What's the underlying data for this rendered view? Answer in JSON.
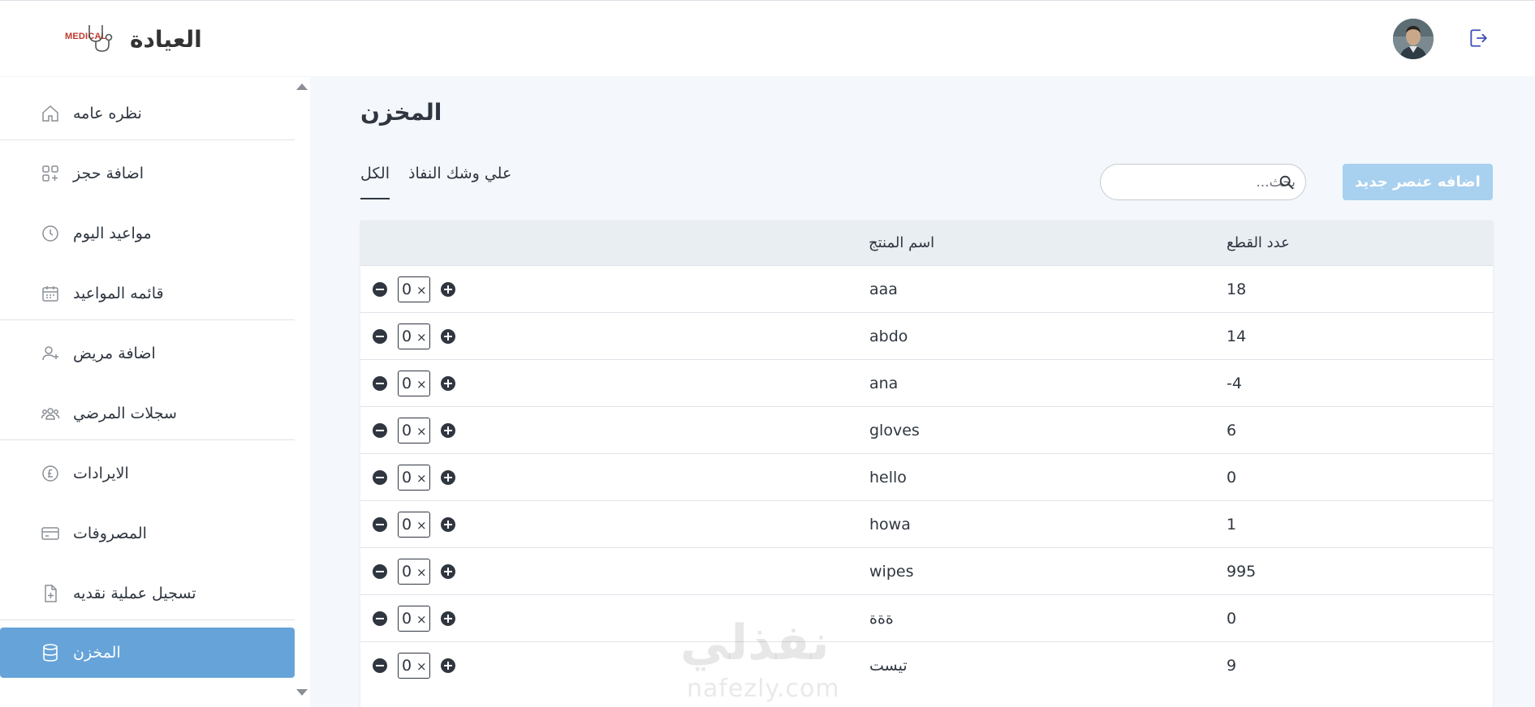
{
  "header": {
    "app_title": "العيادة",
    "logo_text": "MEDICAL",
    "logo_icon": "stethoscope-icon",
    "avatar_icon": "user-avatar",
    "logout_icon": "logout-icon"
  },
  "sidebar": {
    "items": [
      {
        "label": "نظره عامه",
        "icon": "home-icon"
      },
      {
        "label": "اضافة حجز",
        "icon": "grid-plus-icon"
      },
      {
        "label": "مواعيد اليوم",
        "icon": "clock-icon"
      },
      {
        "label": "قائمه المواعيد",
        "icon": "calendar-icon"
      },
      {
        "label": "اضافة مريض",
        "icon": "user-plus-icon"
      },
      {
        "label": "سجلات المرضي",
        "icon": "users-icon"
      },
      {
        "label": "الايرادات",
        "icon": "pound-coin-icon"
      },
      {
        "label": "المصروفات",
        "icon": "card-icon"
      },
      {
        "label": "تسجيل عملية نقديه",
        "icon": "file-plus-icon"
      },
      {
        "label": "المخزن",
        "icon": "database-icon",
        "active": true
      }
    ]
  },
  "main": {
    "title": "المخزن",
    "tabs": [
      {
        "label": "الكل",
        "active": true
      },
      {
        "label": "علي وشك النفاذ",
        "active": false
      }
    ],
    "search_placeholder": "بحث...",
    "add_button_label": "اضافه عنصر جديد",
    "table": {
      "headers": {
        "name": "اسم المنتج",
        "count": "عدد القطع"
      },
      "rows": [
        {
          "qty": "0",
          "name": "aaa",
          "count": "18"
        },
        {
          "qty": "0",
          "name": "abdo",
          "count": "14"
        },
        {
          "qty": "0",
          "name": "ana",
          "count": "-4"
        },
        {
          "qty": "0",
          "name": "gloves",
          "count": "6"
        },
        {
          "qty": "0",
          "name": "hello",
          "count": "0"
        },
        {
          "qty": "0",
          "name": "howa",
          "count": "1"
        },
        {
          "qty": "0",
          "name": "wipes",
          "count": "995"
        },
        {
          "qty": "0",
          "name": "ةةة",
          "count": "0"
        },
        {
          "qty": "0",
          "name": "تيست",
          "count": "9"
        }
      ]
    }
  },
  "watermark": {
    "arabic": "نفذلي",
    "latin": "nafezly.com"
  },
  "colors": {
    "accent": "#66a3d9",
    "add_button": "#a8d0ef",
    "text": "#2f3640"
  }
}
